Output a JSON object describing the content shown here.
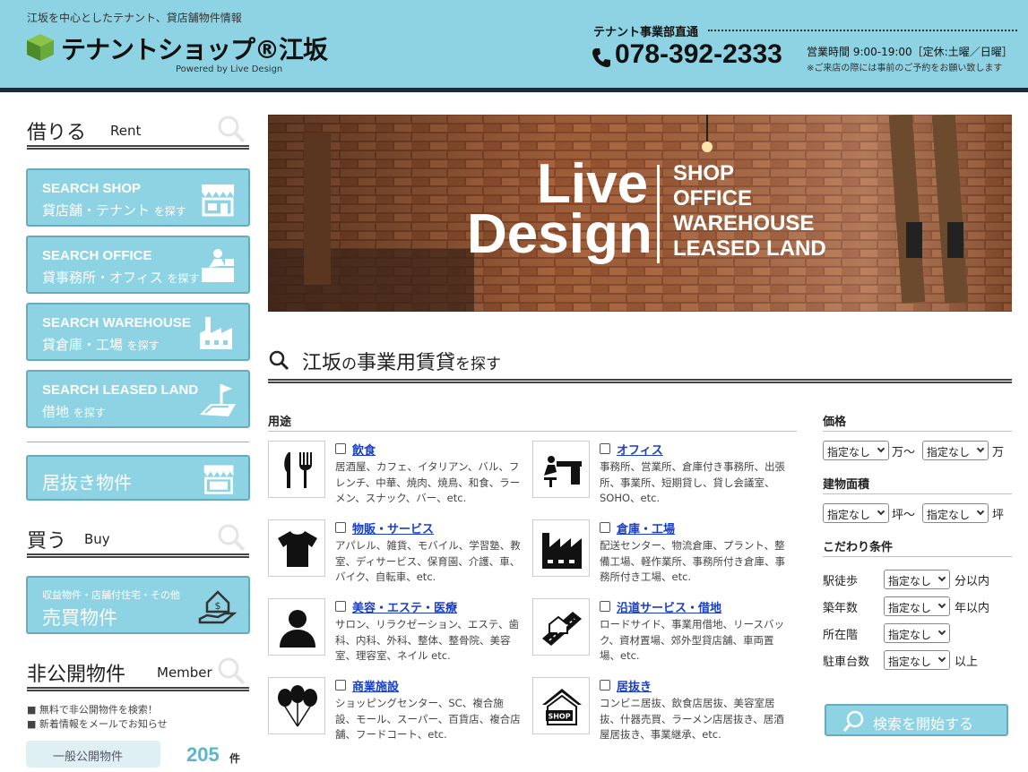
{
  "header": {
    "tagline": "江坂を中心としたテナント、貸店舗物件情報",
    "logo": "テナントショップ®江坂",
    "powered_by": "Powered by  Live Design",
    "direct_label": "テナント事業部直通",
    "phone": "078-392-2333",
    "hours": "営業時間 9:00-19:00［定休:土曜／日曜］",
    "hours_note": "※ご来店の際には事前のご予約をお願い致します"
  },
  "sidebar": {
    "rent_heading": {
      "jp": "借りる",
      "en": "Rent"
    },
    "rent_buttons": [
      {
        "en": "SEARCH SHOP",
        "jp": "貸店舗・テナント",
        "suffix": "を探す"
      },
      {
        "en": "SEARCH OFFICE",
        "jp": "貸事務所・オフィス",
        "suffix": "を探す"
      },
      {
        "en": "SEARCH WAREHOUSE",
        "jp": "貸倉庫・工場",
        "suffix": "を探す"
      },
      {
        "en": "SEARCH LEASED LAND",
        "jp": "借地",
        "suffix": "を探す"
      }
    ],
    "inuki_button": "居抜き物件",
    "buy_heading": {
      "jp": "買う",
      "en": "Buy"
    },
    "buy_button": {
      "sub": "収益物件・店舗付住宅・その他",
      "main": "売買物件"
    },
    "member_heading": {
      "jp": "非公開物件",
      "en": "Member"
    },
    "member_bullets": [
      "無料で非公開物件を検索！",
      "新着情報をメールでお知らせ"
    ],
    "public_tab": "一般公開物件",
    "public_count": "205",
    "public_unit": "件"
  },
  "banner": {
    "line1": "Live",
    "line2": "Design",
    "categories": [
      "SHOP",
      "OFFICE",
      "WAREHOUSE",
      "LEASED LAND"
    ]
  },
  "search": {
    "title_pre": "江坂",
    "title_mid": "の",
    "title_main": "事業用賃貸",
    "title_post": "を探す"
  },
  "usage": {
    "label": "用途",
    "categories": [
      {
        "name": "飲食",
        "icon": "fork-knife-icon",
        "desc": "居酒屋、カフェ、イタリアン、バル、フレンチ、中華、焼肉、焼鳥、和食、ラーメン、スナック、バー、etc."
      },
      {
        "name": "オフィス",
        "icon": "office-desk-icon",
        "desc": "事務所、営業所、倉庫付き事務所、出張所、事業所、短期貸し、貸し会議室、SOHO、etc."
      },
      {
        "name": "物販・サービス",
        "icon": "tshirt-icon",
        "desc": "アパレル、雑貨、モバイル、学習塾、教室、ディサービス、保育園、介護、車、バイク、自転車、etc."
      },
      {
        "name": "倉庫・工場",
        "icon": "factory-icon",
        "desc": "配送センター、物流倉庫、プラント、整備工場、軽作業所、事務所付き倉庫、事務所付き工場、etc."
      },
      {
        "name": "美容・エステ・医療",
        "icon": "person-icon",
        "desc": "サロン、リラクゼーション、エステ、歯科、内科、外科、整体、整骨院、美容室、理容室、ネイル etc."
      },
      {
        "name": "沿道サービス・借地",
        "icon": "roadside-icon",
        "desc": "ロードサイド、事業用借地、リースバック、資材置場、郊外型貸店舗、車両置場、etc."
      },
      {
        "name": "商業施設",
        "icon": "balloons-icon",
        "desc": "ショッピングセンター、SC、複合施設、モール、スーパー、百貨店、複合店舗、フードコート、etc."
      },
      {
        "name": "居抜き",
        "icon": "shop-house-icon",
        "desc": "コンビニ居抜、飲食店居抜、美容室居抜、什器売買、ラーメン店居抜き、居酒屋居抜き、事業継承、etc."
      }
    ]
  },
  "filters": {
    "price_label": "価格",
    "area_label": "建物面積",
    "conditions_label": "こだわり条件",
    "default_option": "指定なし",
    "price_unit": "万",
    "area_unit": "坪",
    "range_sep": "〜",
    "conditions": [
      {
        "label": "駅徒歩",
        "unit": "分以内"
      },
      {
        "label": "築年数",
        "unit": "年以内"
      },
      {
        "label": "所在階",
        "unit": ""
      },
      {
        "label": "駐車台数",
        "unit": "以上"
      }
    ],
    "search_button": "検索を開始する"
  },
  "colors": {
    "accent": "#8dd3e3",
    "dark_bar": "#1a2b3c",
    "link": "#1a3ec8",
    "count": "#5bb5cf"
  }
}
